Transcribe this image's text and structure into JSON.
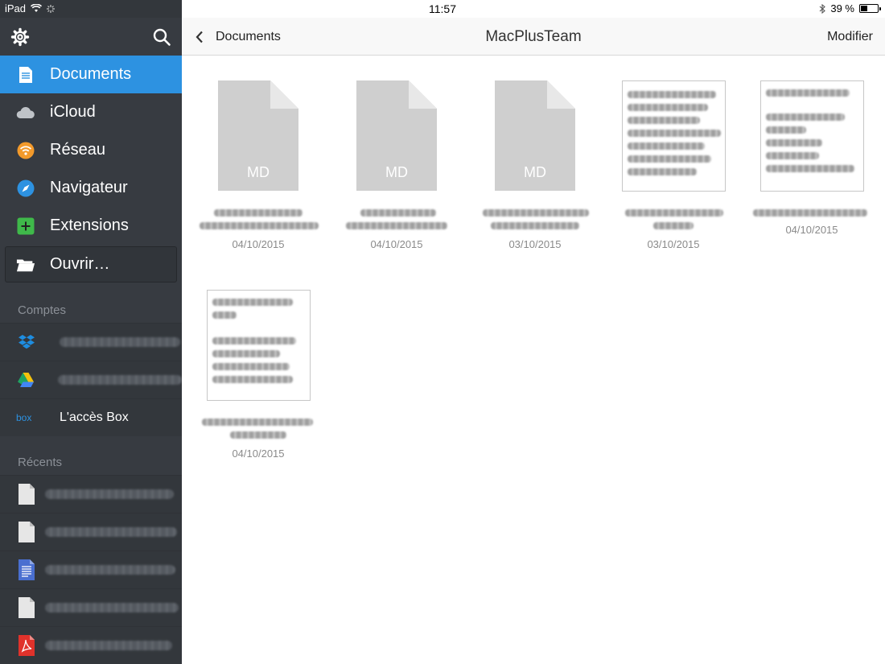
{
  "statusbar": {
    "device": "iPad",
    "time": "11:57",
    "battery": "39 %",
    "battery_level": 0.39
  },
  "sidebar": {
    "nav": [
      {
        "label": "Documents",
        "icon": "document-icon",
        "active": true
      },
      {
        "label": "iCloud",
        "icon": "cloud-icon"
      },
      {
        "label": "Réseau",
        "icon": "network-icon"
      },
      {
        "label": "Navigateur",
        "icon": "compass-icon"
      },
      {
        "label": "Extensions",
        "icon": "plus-icon"
      },
      {
        "label": "Ouvrir…",
        "icon": "folder-icon"
      }
    ],
    "accounts_title": "Comptes",
    "accounts": [
      {
        "label": "",
        "icon": "dropbox-icon"
      },
      {
        "label": "",
        "icon": "google-drive-icon"
      },
      {
        "label": "L'accès Box",
        "icon": "box-icon"
      }
    ],
    "recents_title": "Récents",
    "recents": [
      {
        "icon": "file-icon"
      },
      {
        "icon": "file-icon"
      },
      {
        "icon": "text-document-icon"
      },
      {
        "icon": "file-icon"
      },
      {
        "icon": "pdf-icon"
      }
    ]
  },
  "navbar": {
    "back_label": "Documents",
    "title": "MacPlusTeam",
    "edit_label": "Modifier"
  },
  "files": [
    {
      "type": "md",
      "label": "MD",
      "date": "04/10/2015"
    },
    {
      "type": "md",
      "label": "MD",
      "date": "04/10/2015"
    },
    {
      "type": "md",
      "label": "MD",
      "date": "03/10/2015"
    },
    {
      "type": "preview",
      "date": "03/10/2015"
    },
    {
      "type": "preview",
      "date": "04/10/2015"
    },
    {
      "type": "preview",
      "date": "04/10/2015"
    }
  ],
  "colors": {
    "sidebar_bg": "#373b41",
    "active": "#2d92e1",
    "icloud": "#bfc3c8",
    "network": "#f39a2b",
    "compass": "#2d92e1",
    "extensions": "#3fb94a",
    "dropbox": "#1e8de0",
    "box": "#2d92e1",
    "pdf": "#e0322b"
  }
}
